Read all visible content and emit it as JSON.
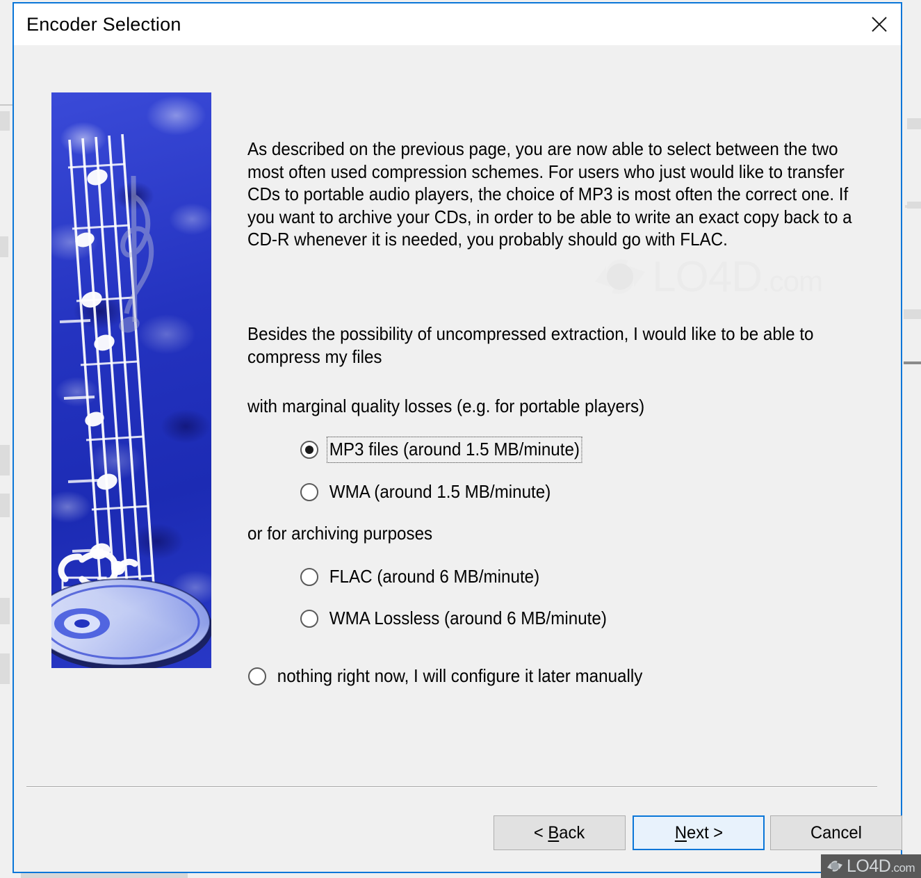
{
  "window": {
    "title": "Encoder Selection",
    "close_icon": "close-icon",
    "border_color": "#0a76d8",
    "titlebar_bg": "#ffffff",
    "body_bg": "#f0f0f0"
  },
  "illustration": {
    "name": "music-cd-banner",
    "description": "Blue textured background with white musical staff, notes, treble clef and a compact disc"
  },
  "content": {
    "paragraph1": "As described on the previous page, you are now able to select between the two most often used compression schemes. For users who just would like to transfer CDs to portable audio players, the choice of MP3 is most often the correct one. If you want to archive your CDs, in order to be able to write an exact copy back to a CD-R whenever it is needed, you probably should go with FLAC.",
    "paragraph2": "Besides the possibility of uncompressed extraction, I would like to be able to compress my files",
    "group_lossy_label": "with marginal quality losses (e.g. for portable players)",
    "group_archive_label": "or for archiving purposes"
  },
  "options": [
    {
      "id": "mp3",
      "label": "MP3 files (around 1.5 MB/minute)",
      "checked": true,
      "focused": true,
      "indent": "deep"
    },
    {
      "id": "wma",
      "label": "WMA (around 1.5 MB/minute)",
      "checked": false,
      "focused": false,
      "indent": "deep"
    },
    {
      "id": "flac",
      "label": "FLAC (around 6 MB/minute)",
      "checked": false,
      "focused": false,
      "indent": "deep"
    },
    {
      "id": "wmalossless",
      "label": "WMA Lossless (around 6 MB/minute)",
      "checked": false,
      "focused": false,
      "indent": "deep"
    },
    {
      "id": "nothing",
      "label": "nothing right now, I will configure it later manually",
      "checked": false,
      "focused": false,
      "indent": "shallow"
    }
  ],
  "footer": {
    "back": {
      "prefix": "< ",
      "accel": "B",
      "rest": "ack"
    },
    "next": {
      "prefix": "",
      "accel": "N",
      "rest": "ext >"
    },
    "cancel": {
      "label": "Cancel"
    },
    "default_button": "next",
    "default_border_color": "#0a76d8",
    "default_fill_color": "#e8f2fc"
  },
  "watermark": {
    "text_main": "LO4D",
    "text_suffix": ".com",
    "badge_bg": "#595959"
  }
}
